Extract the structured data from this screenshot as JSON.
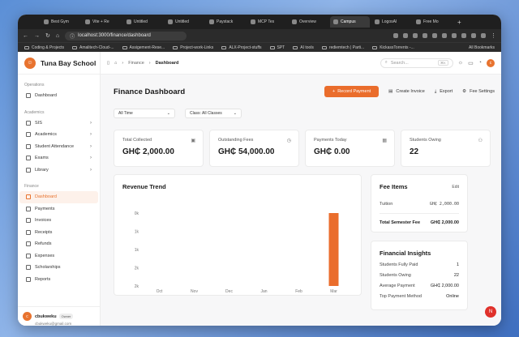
{
  "browser": {
    "tabs": [
      {
        "label": "Best Gym",
        "active": false
      },
      {
        "label": "Vite + Re",
        "active": false
      },
      {
        "label": "Untitled",
        "active": false
      },
      {
        "label": "Untitled",
        "active": false
      },
      {
        "label": "Paystack",
        "active": false
      },
      {
        "label": "MCP Tes",
        "active": false
      },
      {
        "label": "Overview",
        "active": false
      },
      {
        "label": "Campus",
        "active": true
      },
      {
        "label": "LogosAI",
        "active": false
      },
      {
        "label": "Free Mo",
        "active": false
      }
    ],
    "new_tab": "+",
    "url": "localhost:3000/finance/dashboard",
    "bookmarks": [
      "Coding & Projects",
      "Amalitech-Cloud-...",
      "Assigement-Rese...",
      "Project-work-Links",
      "ALX-Project-stuffs",
      "SPT",
      "AI tools",
      "rediemtech | Parti...",
      "KickassTorrents -..."
    ],
    "all_bookmarks": "All Bookmarks"
  },
  "sidebar": {
    "brand": "Tuna Bay School",
    "sections": [
      {
        "title": "Operations",
        "items": [
          {
            "label": "Dashboard",
            "chevron": false,
            "active": false
          }
        ]
      },
      {
        "title": "Academics",
        "items": [
          {
            "label": "SIS",
            "chevron": true,
            "active": false
          },
          {
            "label": "Academics",
            "chevron": true,
            "active": false
          },
          {
            "label": "Student Attendance",
            "chevron": true,
            "active": false
          },
          {
            "label": "Exams",
            "chevron": true,
            "active": false
          },
          {
            "label": "Library",
            "chevron": true,
            "active": false
          }
        ]
      },
      {
        "title": "Finance",
        "items": [
          {
            "label": "Dashboard",
            "chevron": false,
            "active": true
          },
          {
            "label": "Payments",
            "chevron": false,
            "active": false
          },
          {
            "label": "Invoices",
            "chevron": false,
            "active": false
          },
          {
            "label": "Receipts",
            "chevron": false,
            "active": false
          },
          {
            "label": "Refunds",
            "chevron": false,
            "active": false
          },
          {
            "label": "Expenses",
            "chevron": false,
            "active": false
          },
          {
            "label": "Scholarships",
            "chevron": false,
            "active": false
          },
          {
            "label": "Reports",
            "chevron": false,
            "active": false
          }
        ]
      }
    ],
    "user": {
      "initial": "c",
      "name": "cbukweku",
      "role": "Owner",
      "email": "cbukweku@gmail.com"
    }
  },
  "topbar": {
    "crumbs": [
      "Finance",
      "Dashboard"
    ],
    "search_placeholder": "Search...",
    "search_kbd": "⌘K",
    "avatar_initial": "c"
  },
  "page": {
    "title": "Finance Dashboard",
    "record_payment": "Record Payment",
    "create_invoice": "Create Invoice",
    "export": "Export",
    "fee_settings": "Fee Settings",
    "filter_time": "All Time",
    "filter_class": "Class: All Classes"
  },
  "stats": [
    {
      "label": "Total Collected",
      "value": "GH₵ 2,000.00",
      "icon": "receipt-icon"
    },
    {
      "label": "Outstanding Fees",
      "value": "GH₵ 54,000.00",
      "icon": "clock-icon"
    },
    {
      "label": "Payments Today",
      "value": "GH₵ 0.00",
      "icon": "calendar-icon"
    },
    {
      "label": "Students Owing",
      "value": "22",
      "icon": "users-icon"
    }
  ],
  "chart_data": {
    "type": "bar",
    "title": "Revenue Trend",
    "categories": [
      "Oct",
      "Nov",
      "Dec",
      "Jan",
      "Feb",
      "Mar"
    ],
    "values": [
      0,
      0,
      0,
      0,
      0,
      2000
    ],
    "yticks": [
      "0k",
      "1k",
      "1k",
      "2k",
      "2k"
    ],
    "ylim": [
      0,
      2000
    ],
    "color": "#ea6d2c"
  },
  "fee_items": {
    "title": "Fee Items",
    "edit": "Edit",
    "rows": [
      {
        "label": "Tuition",
        "value": "GH₵ 2,000.00"
      }
    ],
    "total_label": "Total Semester Fee",
    "total_value": "GH₵ 2,000.00"
  },
  "insights": {
    "title": "Financial Insights",
    "rows": [
      {
        "label": "Students Fully Paid",
        "value": "1"
      },
      {
        "label": "Students Owing",
        "value": "22"
      },
      {
        "label": "Average Payment",
        "value": "GH₵ 2,000.00"
      },
      {
        "label": "Top Payment Method",
        "value": "Online"
      }
    ]
  },
  "fab": "N"
}
